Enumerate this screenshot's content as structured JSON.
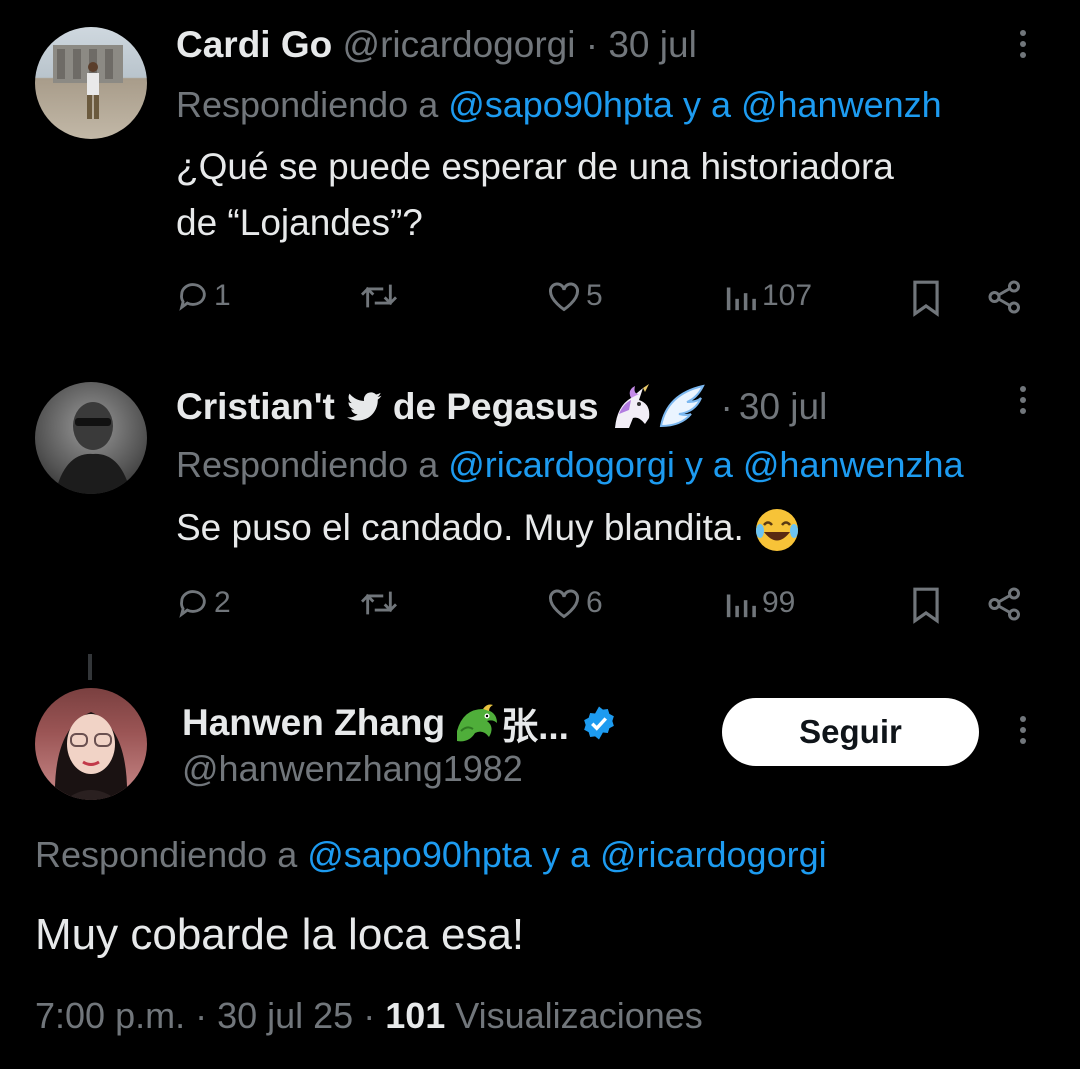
{
  "tweets": [
    {
      "display_name": "Cardi Go",
      "handle": "@ricardogorgi",
      "sep": "·",
      "date": "30 jul",
      "replying_prefix": "Respondiendo a ",
      "replying_to_1": "@sapo90hpta",
      "replying_and": " y a ",
      "replying_to_2": "@hanwenzh",
      "text_line1": "¿Qué se puede esperar de una historiadora",
      "text_line2": "de “Lojandes”?",
      "replies": "1",
      "likes": "5",
      "views": "107"
    },
    {
      "display_name_a": "Cristian't",
      "display_name_b": "de Pegasus",
      "sep": "·",
      "date": "30 jul",
      "replying_prefix": "Respondiendo a ",
      "replying_to_1": "@ricardogorgi",
      "replying_and": " y a ",
      "replying_to_2": "@hanwenzha",
      "text": "Se puso el candado. Muy blandita.",
      "replies": "2",
      "likes": "6",
      "views": "99"
    }
  ],
  "main_tweet": {
    "display_name": "Hanwen Zhang",
    "name_suffix": "张...",
    "handle": "@hanwenzhang1982",
    "follow_label": "Seguir",
    "replying_prefix": "Respondiendo a ",
    "replying_to_1": "@sapo90hpta",
    "replying_and": " y a ",
    "replying_to_2": "@ricardogorgi",
    "text": "Muy cobarde la loca esa!",
    "time": "7:00 p.m.",
    "sep1": " · ",
    "date": "30 jul 25",
    "sep2": " · ",
    "views_count": "101",
    "views_label": " Visualizaciones"
  },
  "colors": {
    "background": "#000000",
    "text": "#e7e9ea",
    "muted": "#71767b",
    "link": "#1d9bf0",
    "verified": "#1d9bf0"
  },
  "icons": [
    "reply-icon",
    "retweet-icon",
    "like-icon",
    "views-icon",
    "bookmark-icon",
    "share-icon",
    "more-icon",
    "bird-icon",
    "unicorn-emoji",
    "wing-emoji",
    "laughing-emoji",
    "dragon-emoji",
    "verified-icon"
  ]
}
